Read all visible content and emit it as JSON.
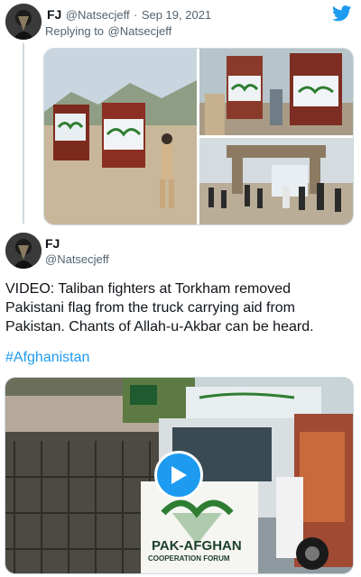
{
  "tweet1": {
    "display_name": "FJ",
    "handle": "@Natsecjeff",
    "separator": "·",
    "date": "Sep 19, 2021",
    "reply_prefix": "Replying to",
    "reply_to": "@Natsecjeff"
  },
  "tweet2": {
    "display_name": "FJ",
    "handle": "@Natsecjeff",
    "text_lines": [
      "VIDEO: Taliban fighters at Torkham removed",
      "Pakistani flag from the truck carrying aid from",
      "Pakistan. Chants of Allah-u-Akbar can be heard."
    ],
    "hashtag": "#Afghanistan"
  },
  "video_banner": {
    "line1": "PAK-AFGHAN",
    "line2": "COOPERATION FORUM"
  },
  "icons": {
    "brand": "twitter-bird-icon",
    "play": "play-icon"
  },
  "colors": {
    "accent": "#1d9bf0",
    "text": "#0f1419",
    "muted": "#536471",
    "divider": "#cfd9de"
  }
}
